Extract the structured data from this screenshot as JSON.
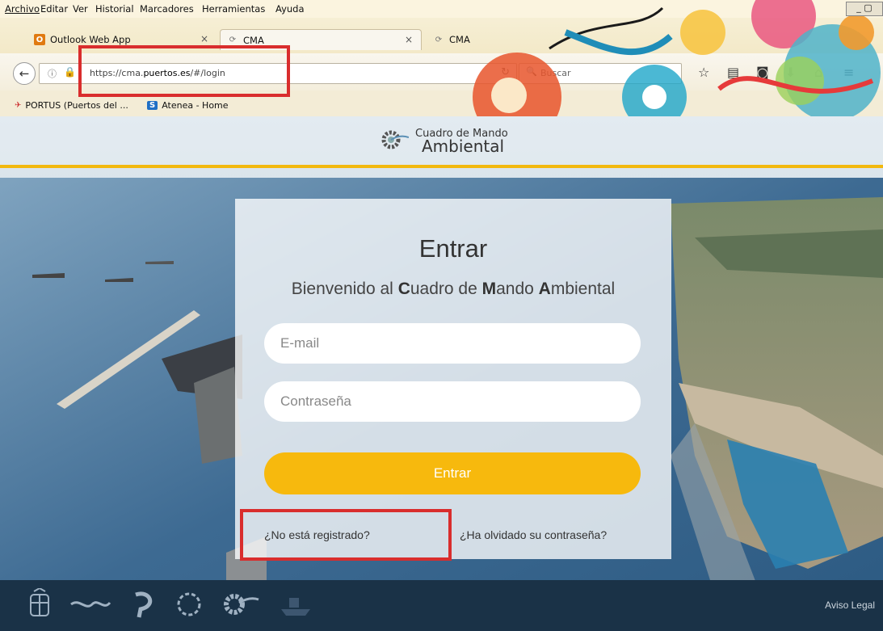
{
  "menu": [
    "Archivo",
    "Editar",
    "Ver",
    "Historial",
    "Marcadores",
    "Herramientas",
    "Ayuda"
  ],
  "tabs": [
    {
      "label": "Outlook Web App",
      "close": "×"
    },
    {
      "label": "CMA",
      "close": "×"
    },
    {
      "label": "CMA"
    }
  ],
  "address": {
    "prefix": "https://cma.",
    "domain": "puertos.es",
    "path": "/#/login"
  },
  "search": {
    "placeholder": "Buscar"
  },
  "bookmarks": [
    "PORTUS (Puertos del ...",
    "Atenea - Home"
  ],
  "bookmark_icon_sp": "S",
  "brand": {
    "line1": "Cuadro de Mando",
    "line2": "Ambiental"
  },
  "login": {
    "title": "Entrar",
    "welcome_prefix": "Bienvenido al ",
    "welcome_c": "C",
    "welcome_uadro": "uadro de ",
    "welcome_m": "M",
    "welcome_ando": "ando ",
    "welcome_a": "A",
    "welcome_mbiental": "mbiental",
    "email_placeholder": "E-mail",
    "password_placeholder": "Contraseña",
    "submit_label": "Entrar",
    "register_link": "¿No está registrado?",
    "forgot_link": "¿Ha olvidado su contraseña?"
  },
  "footer": {
    "legal_link": "Aviso Legal"
  },
  "colors": {
    "accent": "#f7b90d",
    "footer": "#1a3247",
    "highlight": "#d92d2d"
  }
}
